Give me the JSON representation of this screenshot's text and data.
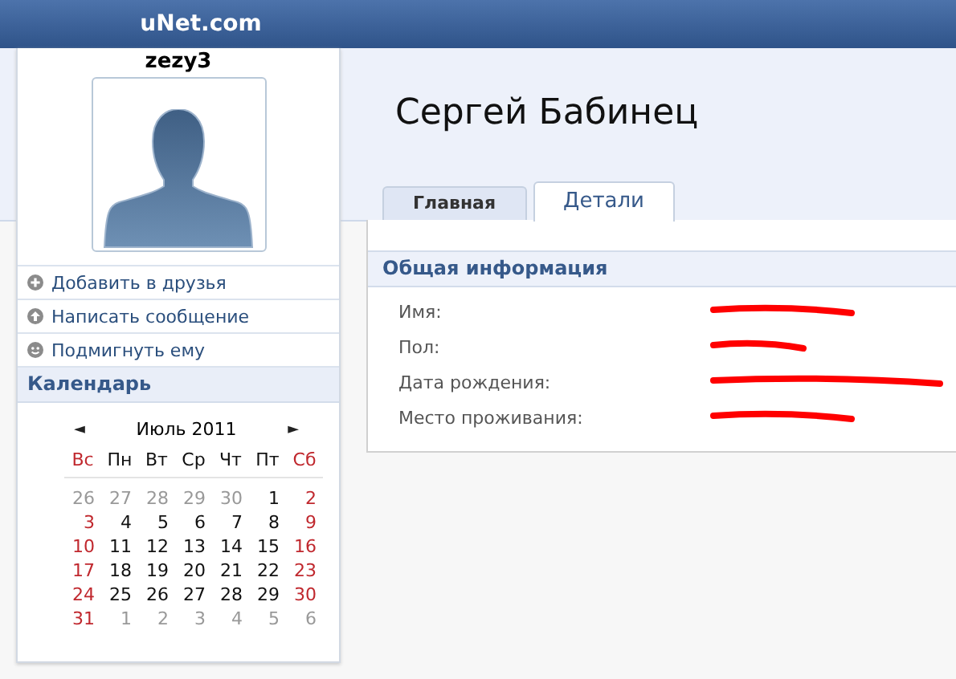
{
  "header": {
    "site": "uNet.com"
  },
  "profile": {
    "username": "zezy3",
    "full_name": "Сергей Бабинец"
  },
  "actions": [
    {
      "label": "Добавить в друзья",
      "kind": "add"
    },
    {
      "label": "Написать сообщение",
      "kind": "message"
    },
    {
      "label": "Подмигнуть ему",
      "kind": "wink"
    }
  ],
  "calendar": {
    "title": "Календарь",
    "month": "Июль 2011",
    "prev": "◄",
    "next": "►",
    "weekdays": [
      {
        "label": "Вс",
        "weekend": true
      },
      {
        "label": "Пн",
        "weekend": false
      },
      {
        "label": "Вт",
        "weekend": false
      },
      {
        "label": "Ср",
        "weekend": false
      },
      {
        "label": "Чт",
        "weekend": false
      },
      {
        "label": "Пт",
        "weekend": false
      },
      {
        "label": "Сб",
        "weekend": true
      }
    ],
    "weeks": [
      [
        {
          "d": "26",
          "kind": "other"
        },
        {
          "d": "27",
          "kind": "other"
        },
        {
          "d": "28",
          "kind": "other"
        },
        {
          "d": "29",
          "kind": "other"
        },
        {
          "d": "30",
          "kind": "other"
        },
        {
          "d": "1",
          "kind": "day"
        },
        {
          "d": "2",
          "kind": "weekend"
        }
      ],
      [
        {
          "d": "3",
          "kind": "weekend"
        },
        {
          "d": "4",
          "kind": "day"
        },
        {
          "d": "5",
          "kind": "day"
        },
        {
          "d": "6",
          "kind": "day"
        },
        {
          "d": "7",
          "kind": "day"
        },
        {
          "d": "8",
          "kind": "day"
        },
        {
          "d": "9",
          "kind": "weekend"
        }
      ],
      [
        {
          "d": "10",
          "kind": "weekend"
        },
        {
          "d": "11",
          "kind": "day"
        },
        {
          "d": "12",
          "kind": "day"
        },
        {
          "d": "13",
          "kind": "day"
        },
        {
          "d": "14",
          "kind": "day"
        },
        {
          "d": "15",
          "kind": "day"
        },
        {
          "d": "16",
          "kind": "weekend"
        }
      ],
      [
        {
          "d": "17",
          "kind": "weekend"
        },
        {
          "d": "18",
          "kind": "day"
        },
        {
          "d": "19",
          "kind": "day"
        },
        {
          "d": "20",
          "kind": "day"
        },
        {
          "d": "21",
          "kind": "day"
        },
        {
          "d": "22",
          "kind": "day"
        },
        {
          "d": "23",
          "kind": "weekend"
        }
      ],
      [
        {
          "d": "24",
          "kind": "weekend"
        },
        {
          "d": "25",
          "kind": "day"
        },
        {
          "d": "26",
          "kind": "day"
        },
        {
          "d": "27",
          "kind": "day"
        },
        {
          "d": "28",
          "kind": "day"
        },
        {
          "d": "29",
          "kind": "day"
        },
        {
          "d": "30",
          "kind": "weekend"
        }
      ],
      [
        {
          "d": "31",
          "kind": "weekend"
        },
        {
          "d": "1",
          "kind": "other"
        },
        {
          "d": "2",
          "kind": "other"
        },
        {
          "d": "3",
          "kind": "other"
        },
        {
          "d": "4",
          "kind": "other"
        },
        {
          "d": "5",
          "kind": "other"
        },
        {
          "d": "6",
          "kind": "other"
        }
      ]
    ]
  },
  "tabs": [
    {
      "label": "Главная",
      "selected": false
    },
    {
      "label": "Детали",
      "selected": true
    }
  ],
  "section": {
    "title": "Общая информация",
    "rows": [
      {
        "label": "Имя:",
        "redacted": true
      },
      {
        "label": "Пол:",
        "redacted": true
      },
      {
        "label": "Дата рождения:",
        "redacted": true
      },
      {
        "label": "Место проживания:",
        "redacted": true
      }
    ]
  }
}
